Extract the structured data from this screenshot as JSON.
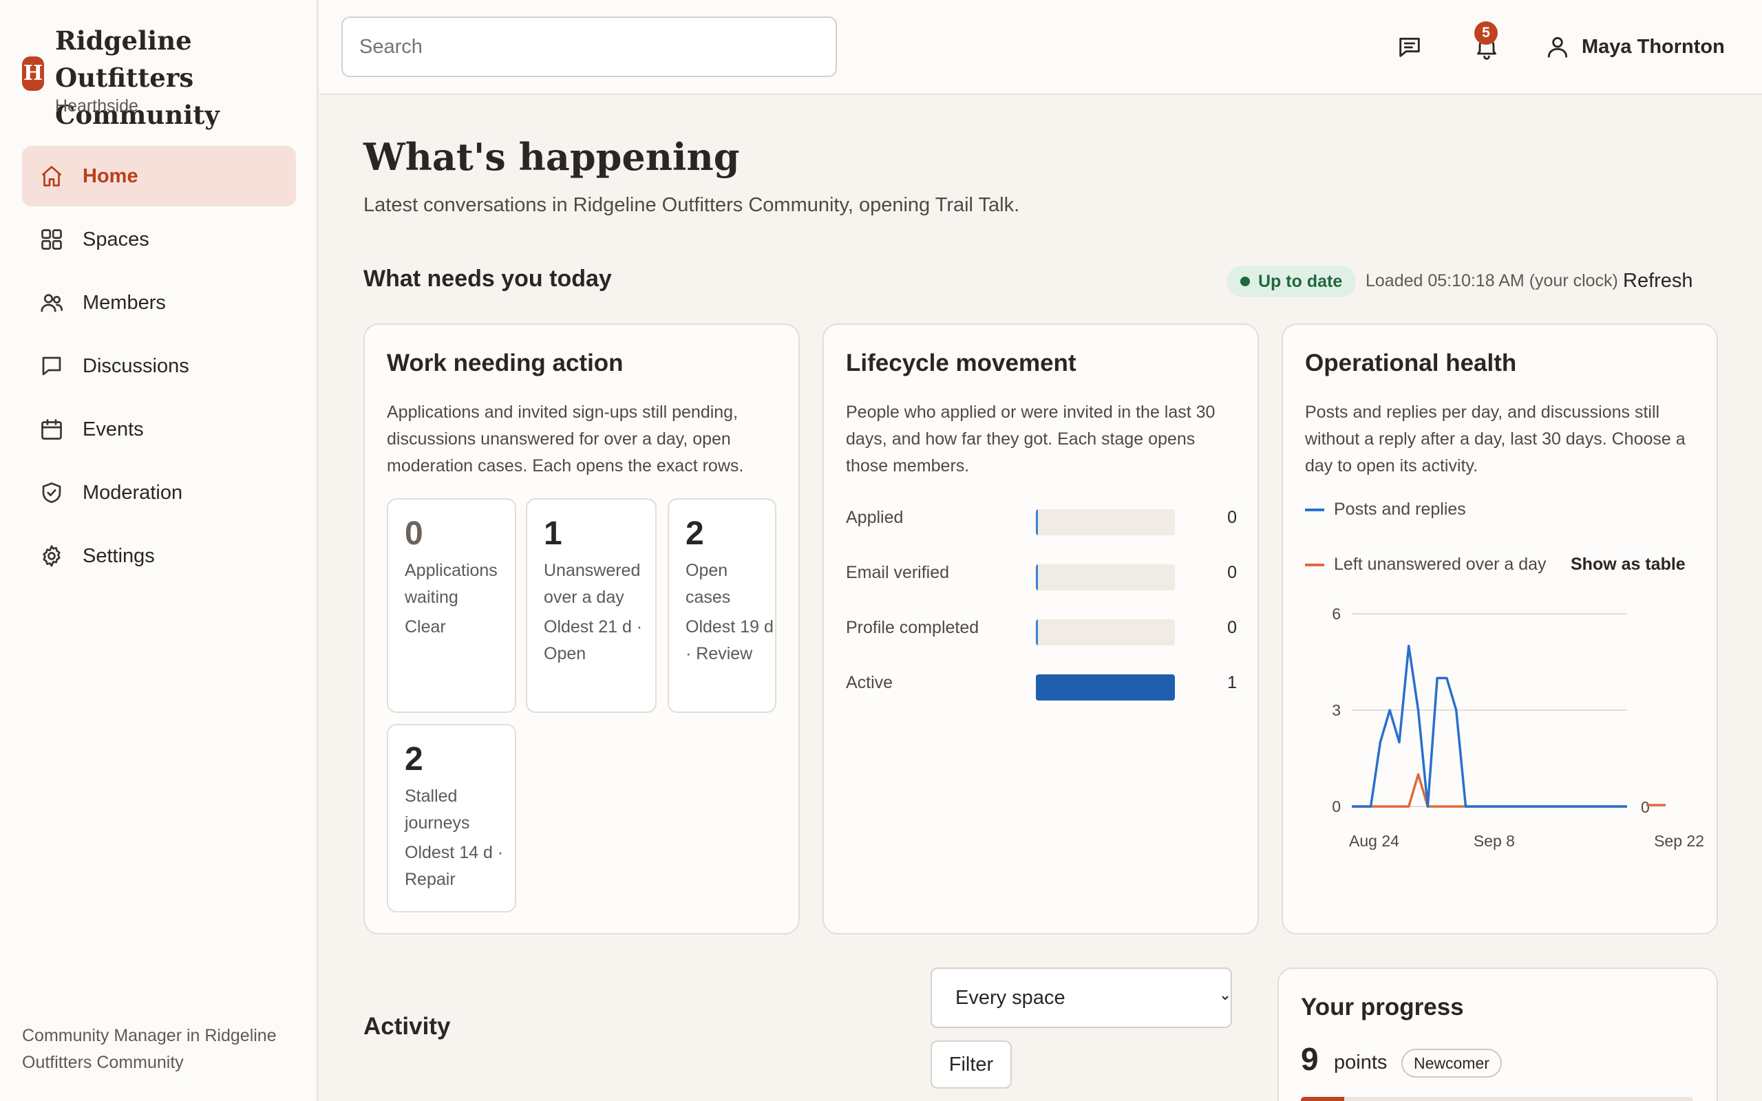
{
  "brand": {
    "title": "Ridgeline Outfitters Community",
    "subtitle": "Hearthside",
    "logo_letter": "H",
    "accent_color": "#c0431f"
  },
  "sidebar": {
    "items": [
      {
        "label": "Home",
        "icon": "home-icon",
        "active": true
      },
      {
        "label": "Spaces",
        "icon": "grid-icon"
      },
      {
        "label": "Members",
        "icon": "users-icon"
      },
      {
        "label": "Discussions",
        "icon": "chat-icon"
      },
      {
        "label": "Events",
        "icon": "calendar-icon"
      },
      {
        "label": "Moderation",
        "icon": "shield-icon"
      },
      {
        "label": "Settings",
        "icon": "gear-icon"
      }
    ],
    "footer": "Community Manager in Ridgeline Outfitters Community"
  },
  "topbar": {
    "search_placeholder": "Search",
    "notification_count": "5",
    "user_name": "Maya Thornton"
  },
  "main": {
    "title": "What's happening",
    "subtitle": "Latest conversations in Ridgeline Outfitters Community, opening Trail Talk.",
    "section_title": "What needs you today",
    "status": "Up to date",
    "loaded": "Loaded 05:10:18 AM (your clock)",
    "refresh_label": "Refresh"
  },
  "work_card": {
    "title": "Work needing action",
    "description": "Applications and invited sign-ups still pending, discussions unanswered for over a day, open moderation cases. Each opens the exact rows.",
    "tiles": [
      {
        "num": "0",
        "label": "Applications waiting",
        "meta": "Clear"
      },
      {
        "num": "1",
        "label": "Unanswered over a day",
        "meta": "Oldest 21 d · Open"
      },
      {
        "num": "2",
        "label": "Open cases",
        "meta": "Oldest 19 d · Review"
      },
      {
        "num": "2",
        "label": "Stalled journeys",
        "meta": "Oldest 14 d · Repair"
      }
    ]
  },
  "lifecycle_card": {
    "title": "Lifecycle movement",
    "description": "People who applied or were invited in the last 30 days, and how far they got. Each stage opens those members.",
    "stages": [
      {
        "label": "Applied",
        "value": "0",
        "fraction": 0
      },
      {
        "label": "Email verified",
        "value": "0",
        "fraction": 0
      },
      {
        "label": "Profile completed",
        "value": "0",
        "fraction": 0
      },
      {
        "label": "Active",
        "value": "1",
        "fraction": 1
      }
    ],
    "bar_color": "#1f5fae"
  },
  "health_card": {
    "title": "Operational health",
    "description": "Posts and replies per day, and discussions still without a reply after a day, last 30 days. Choose a day to open its activity.",
    "show_table_label": "Show as table"
  },
  "chart_data": {
    "type": "line",
    "x": [
      "Aug 24",
      "Aug 25",
      "Aug 26",
      "Aug 27",
      "Aug 28",
      "Aug 29",
      "Aug 30",
      "Aug 31",
      "Sep 1",
      "Sep 2",
      "Sep 3",
      "Sep 4",
      "Sep 5",
      "Sep 6",
      "Sep 7",
      "Sep 8",
      "Sep 9",
      "Sep 10",
      "Sep 11",
      "Sep 12",
      "Sep 13",
      "Sep 14",
      "Sep 15",
      "Sep 16",
      "Sep 17",
      "Sep 18",
      "Sep 19",
      "Sep 20",
      "Sep 21",
      "Sep 22"
    ],
    "x_ticks": [
      "Aug 24",
      "Sep 8",
      "Sep 22"
    ],
    "y_ticks": [
      "0",
      "3",
      "6"
    ],
    "ylim": [
      0,
      6
    ],
    "series": [
      {
        "name": "Posts and replies",
        "color": "#2a6fd0",
        "values": [
          0,
          0,
          0,
          2,
          3,
          2,
          5,
          3,
          0,
          4,
          4,
          3,
          0,
          0,
          0,
          0,
          0,
          0,
          0,
          0,
          0,
          0,
          0,
          0,
          0,
          0,
          0,
          0,
          0,
          0
        ]
      },
      {
        "name": "Left unanswered over a day",
        "color": "#e06a3a",
        "values": [
          0,
          0,
          0,
          0,
          0,
          0,
          0,
          1,
          0,
          0,
          0,
          0,
          0,
          0,
          0,
          0,
          0,
          0,
          0,
          0,
          0,
          0,
          0,
          0,
          0,
          0,
          0,
          0,
          0,
          0
        ]
      }
    ],
    "end_label": "0",
    "grid": true,
    "legend": "top"
  },
  "bottom": {
    "activity_title": "Activity",
    "space_select": "Every space",
    "filter_label": "Filter",
    "progress_title": "Your progress",
    "points": "9",
    "points_label": "points",
    "level": "Newcomer",
    "progress_fraction": 0.11
  }
}
